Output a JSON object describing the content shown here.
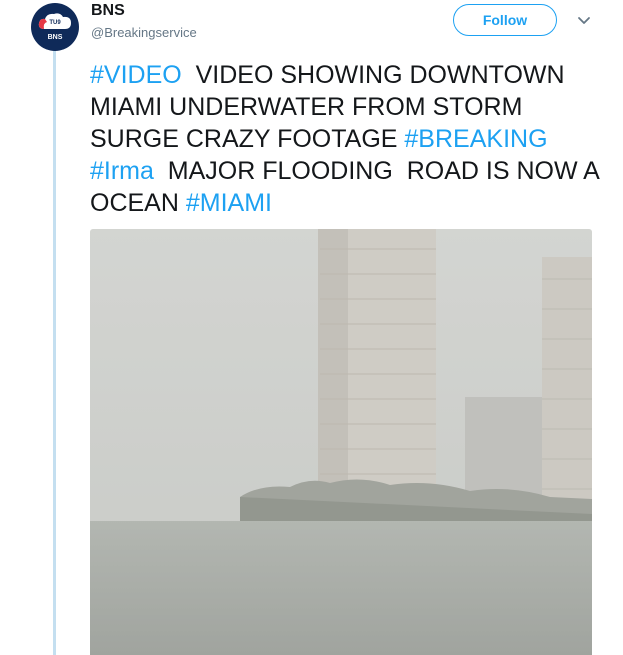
{
  "account": {
    "display_name": "BNS",
    "handle": "@Breakingservice",
    "avatar_top_text": "TU9",
    "avatar_bottom_text": "BNS"
  },
  "follow_button": {
    "label": "Follow"
  },
  "tweet": {
    "parts": [
      {
        "text": "#VIDEO",
        "type": "hashtag"
      },
      {
        "text": "  VIDEO SHOWING DOWNTOWN MIAMI UNDERWATER FROM STORM SURGE CRAZY FOOTAGE ",
        "type": "text"
      },
      {
        "text": "#BREAKING",
        "type": "hashtag"
      },
      {
        "text": " ",
        "type": "text"
      },
      {
        "text": "#Irma",
        "type": "hashtag"
      },
      {
        "text": "  MAJOR FLOODING  ROAD IS NOW A OCEAN ",
        "type": "text"
      },
      {
        "text": "#MIAMI",
        "type": "hashtag"
      }
    ]
  },
  "icons": {
    "caret": "chevron-down-icon",
    "avatar_logo": "cloud-logo-icon"
  },
  "colors": {
    "accent": "#1da1f2",
    "text": "#14171a",
    "muted": "#657786",
    "thread_line": "#c4dff0",
    "avatar_bg": "#0f2a59"
  }
}
